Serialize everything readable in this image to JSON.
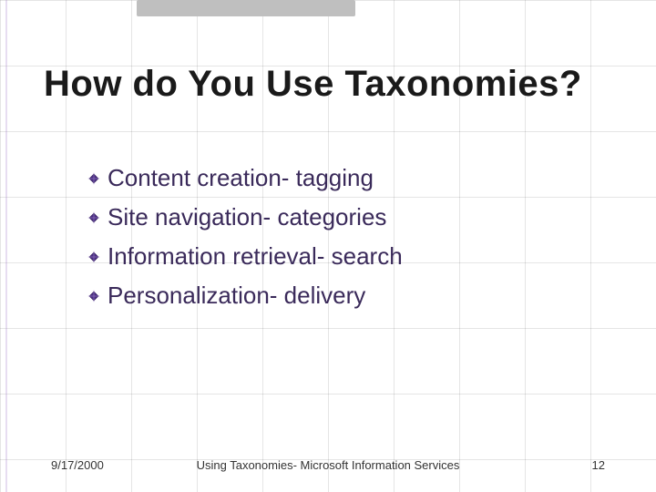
{
  "title": "How do You Use Taxonomies?",
  "bullets": [
    "Content creation- tagging",
    "Site navigation- categories",
    "Information retrieval- search",
    "Personalization- delivery"
  ],
  "footer": {
    "date": "9/17/2000",
    "center": "Using Taxonomies- Microsoft Information Services",
    "page": "12"
  },
  "colors": {
    "bullet_fill": "#4b2e83",
    "bullet_text": "#3a2a5a",
    "title_text": "#1a1a1a",
    "top_tab": "#bfbfbf"
  }
}
